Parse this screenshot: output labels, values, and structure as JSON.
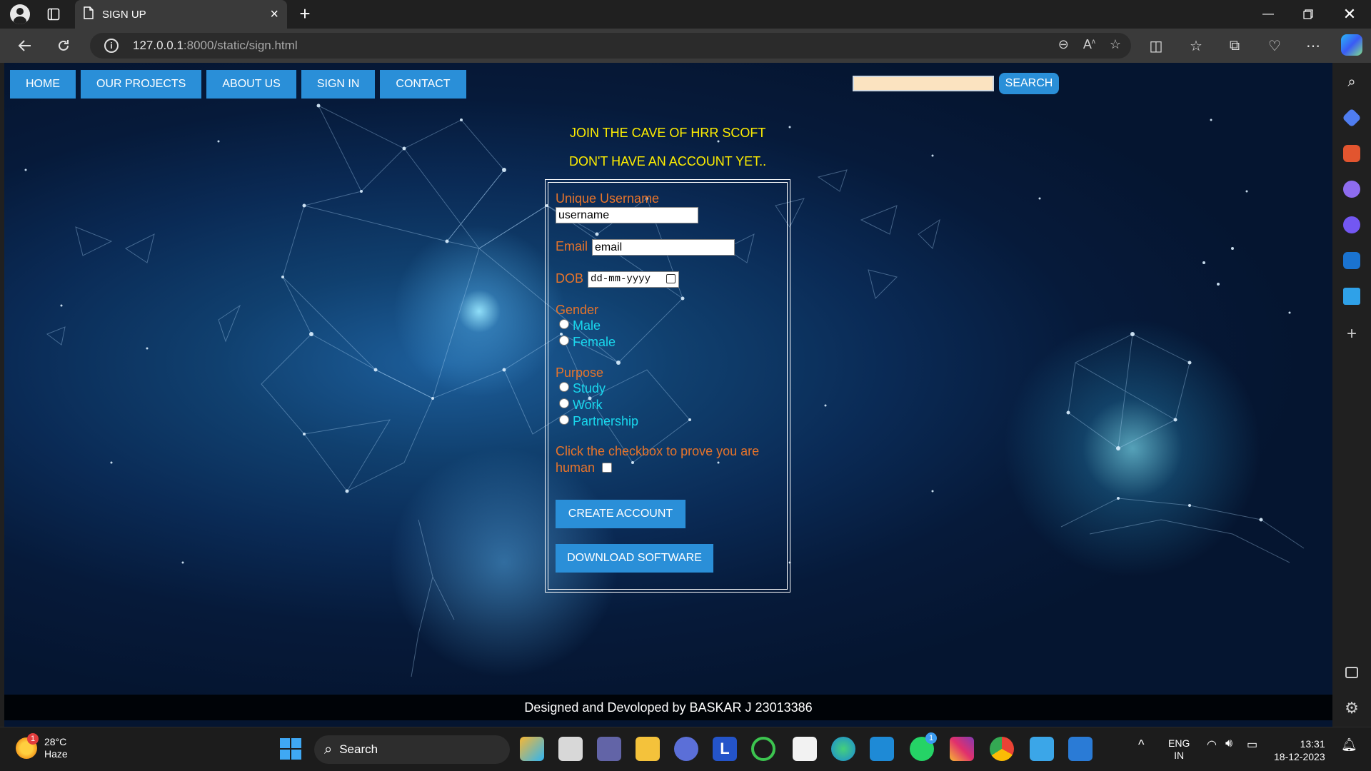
{
  "browser": {
    "tab_title": "SIGN UP",
    "url_host": "127.0.0.1",
    "url_rest": ":8000/static/sign.html"
  },
  "nav": {
    "items": [
      "HOME",
      "OUR PROJECTS",
      "ABOUT US",
      "SIGN IN",
      "CONTACT"
    ],
    "search_value": "",
    "search_button": "SEARCH"
  },
  "headings": {
    "join": "JOIN THE CAVE OF HRR SCOFT",
    "no_account": "DON'T HAVE AN ACCOUNT YET.."
  },
  "form": {
    "username_label": "Unique Username",
    "username_value": "username",
    "email_label": "Email",
    "email_value": "email",
    "dob_label": "DOB",
    "dob_value": "dd-mm-yyyy",
    "gender_label": "Gender",
    "gender_options": [
      "Male",
      "Female"
    ],
    "purpose_label": "Purpose",
    "purpose_options": [
      "Study",
      "Work",
      "Partnership"
    ],
    "human_label_1": "Click the checkbox to prove you are",
    "human_label_2": "human",
    "create_button": "CREATE ACCOUNT",
    "download_button": "DOWNLOAD SOFTWARE"
  },
  "footer": "Designed and Devoloped by BASKAR J 23013386",
  "taskbar": {
    "weather_temp": "28°C",
    "weather_desc": "Haze",
    "weather_badge": "1",
    "search_label": "Search",
    "lang_1": "ENG",
    "lang_2": "IN",
    "time": "13:31",
    "date": "18-12-2023",
    "whatsapp_badge": "1"
  },
  "colors": {
    "nav_blue": "#2a8fd8",
    "heading_yellow": "#ffee00",
    "label_orange": "#e8742a",
    "option_cyan": "#19d8ee"
  }
}
